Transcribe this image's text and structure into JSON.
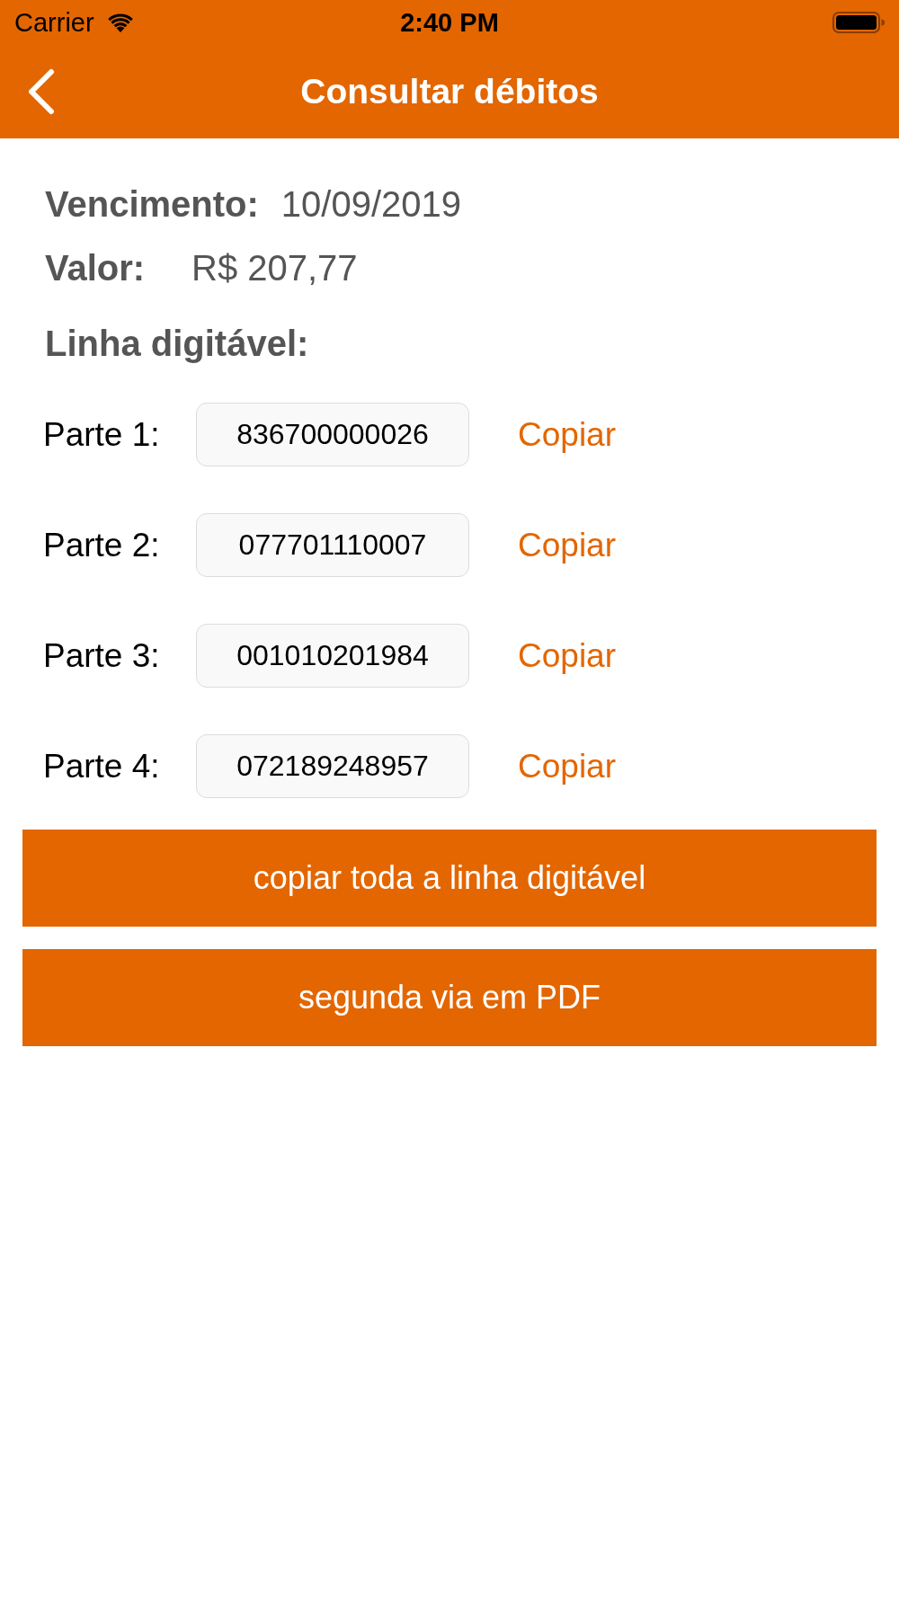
{
  "status_bar": {
    "carrier": "Carrier",
    "time": "2:40 PM"
  },
  "nav_bar": {
    "title": "Consultar débitos"
  },
  "details": [
    {
      "label": "Vencimento:",
      "value": "10/09/2019"
    },
    {
      "label": "Valor:",
      "value": "R$ 207,77"
    }
  ],
  "section_title": "Linha digitável:",
  "parts": [
    {
      "label": "Parte 1:",
      "value": "836700000026",
      "action": "Copiar"
    },
    {
      "label": "Parte 2:",
      "value": "077701110007",
      "action": "Copiar"
    },
    {
      "label": "Parte 3:",
      "value": "001010201984",
      "action": "Copiar"
    },
    {
      "label": "Parte 4:",
      "value": "072189248957",
      "action": "Copiar"
    }
  ],
  "buttons": [
    "copiar toda a linha digitável",
    "segunda via em PDF"
  ]
}
